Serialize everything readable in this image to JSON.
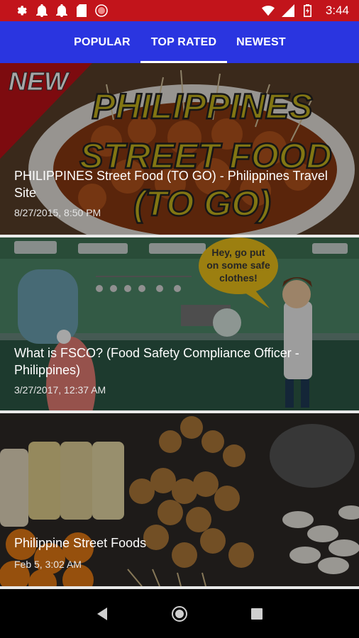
{
  "status_bar": {
    "time": "3:44",
    "left_icons": [
      "gear-icon",
      "bell-icon",
      "bell-icon",
      "sd-card-icon",
      "record-icon"
    ],
    "right_icons": [
      "wifi-icon",
      "signal-icon",
      "battery-icon"
    ]
  },
  "tabs": [
    {
      "label": "POPULAR",
      "active": false
    },
    {
      "label": "TOP RATED",
      "active": true
    },
    {
      "label": "NEWEST",
      "active": false
    }
  ],
  "videos": [
    {
      "title": "PHILIPPINES Street Food (TO GO) - Philippines Travel Site",
      "date": "8/27/2015, 8:50 PM",
      "thumb_text": "PHILIPPINES STREET FOOD (TO GO)",
      "thumb_badge": "NEW"
    },
    {
      "title": "What is FSCO? (Food Safety Compliance Officer - Philippines)",
      "date": "3/27/2017, 12:37 AM",
      "thumb_speech": "Hey, go put on some safe clothes!"
    },
    {
      "title": "Philippine Street Foods",
      "date": "Feb 5, 3:02 AM"
    }
  ],
  "nav": [
    "back-icon",
    "home-icon",
    "recents-icon"
  ],
  "colors": {
    "status_bar": "#c2141b",
    "tab_bar": "#2a35e0",
    "tab_indicator": "#ffffff"
  }
}
